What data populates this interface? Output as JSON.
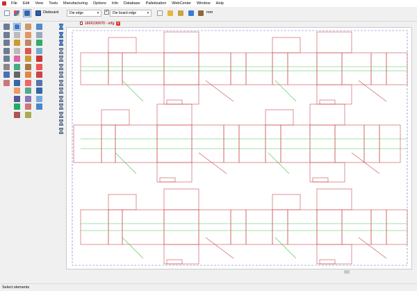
{
  "menu": {
    "items": [
      "File",
      "Edit",
      "View",
      "Tools",
      "Manufacturing",
      "Options",
      "Info",
      "Database",
      "Palletization",
      "WebCenter",
      "Window",
      "Help"
    ]
  },
  "toolbar": {
    "dieboard_label": "Dieboard",
    "combo_left_value": "Die edge",
    "combo_right_value": "Die board edge",
    "unit_label": "mm"
  },
  "document": {
    "tab_title": "160X130X70 - mfg",
    "close_label": "×"
  },
  "status": {
    "text": "Select elements"
  },
  "colors": {
    "cut": "#c8484f",
    "crease": "#4fc14f",
    "border": "#6a6ad0",
    "accent": "#e23b35"
  },
  "icons": {
    "toolbar": [
      "new-file-icon",
      "cad-file-icon",
      "save-icon",
      "dieboard-icon",
      "layout-icon",
      "grid-icon",
      "tool-icon",
      "book-icon",
      "pallet-icon"
    ],
    "palette_col1": [
      "zoom-in-icon",
      "zoom-out-icon",
      "zoom-window-icon",
      "zoom-previous-icon",
      "pan-icon",
      "measure-icon",
      "select-icon",
      "properties-icon"
    ],
    "palette_col2": [
      "pointer-icon",
      "select-window-icon",
      "select-chain-icon",
      "move-icon",
      "rotate-icon",
      "hand-icon",
      "print-icon",
      "text-icon",
      "layer-icon",
      "dimension-icon",
      "bridge-icon",
      "rubber-icon"
    ],
    "palette_col3": [
      "line-icon",
      "rectangle-icon",
      "arc-icon",
      "circle-icon",
      "offset-icon",
      "trim-icon",
      "extend-icon",
      "fillet-icon",
      "mirror-icon",
      "array-icon",
      "break-icon",
      "join-icon"
    ],
    "palette_col4": [
      "strip-icon",
      "blank-icon",
      "layout-tool-icon",
      "nest-icon",
      "cutting-icon",
      "punch-icon",
      "counter-icon",
      "stripping-icon",
      "blanking-icon",
      "ejection-icon",
      "plate-icon"
    ]
  }
}
